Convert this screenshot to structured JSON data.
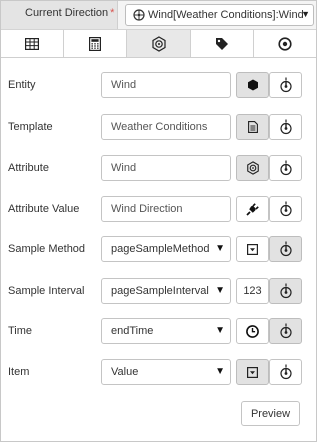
{
  "header": {
    "label": "Current Direction",
    "required_marker": "*",
    "selected": "Wind[Weather Conditions]:Wind Direction"
  },
  "tabs": [
    {
      "icon": "table-icon",
      "active": false
    },
    {
      "icon": "calculator-icon",
      "active": false
    },
    {
      "icon": "wind-icon",
      "active": true
    },
    {
      "icon": "tag-icon",
      "active": false
    },
    {
      "icon": "target-icon",
      "active": false
    }
  ],
  "rows": [
    {
      "label": "Entity",
      "value": "Wind",
      "kind": "text",
      "button1_icon": "hexagon-icon",
      "button1_pressed": true,
      "button2_icon": "pin-icon",
      "button2_pressed": false
    },
    {
      "label": "Template",
      "value": "Weather Conditions",
      "kind": "text",
      "button1_icon": "document-icon",
      "button1_pressed": true,
      "button2_icon": "pin-icon",
      "button2_pressed": false
    },
    {
      "label": "Attribute",
      "value": "Wind",
      "kind": "text",
      "button1_icon": "wind-icon",
      "button1_pressed": true,
      "button2_icon": "pin-icon",
      "button2_pressed": false
    },
    {
      "label": "Attribute Value",
      "value": "Wind Direction",
      "kind": "text",
      "button1_icon": "plug-icon",
      "button1_pressed": false,
      "button2_icon": "pin-icon",
      "button2_pressed": false
    },
    {
      "label": "Sample Method",
      "value": "pageSampleMethod",
      "kind": "select",
      "button1_icon": "dropdown-icon",
      "button1_pressed": false,
      "button2_icon": "pin-icon",
      "button2_pressed": true
    },
    {
      "label": "Sample Interval",
      "value": "pageSampleInterval",
      "kind": "select",
      "button1_text": "123",
      "button1_pressed": false,
      "button2_icon": "pin-icon",
      "button2_pressed": true
    },
    {
      "label": "Time",
      "value": "endTime",
      "kind": "select",
      "button1_icon": "clock-icon",
      "button1_pressed": false,
      "button2_icon": "pin-icon",
      "button2_pressed": true
    },
    {
      "label": "Item",
      "value": "Value",
      "kind": "select",
      "button1_icon": "dropdown-icon",
      "button1_pressed": true,
      "button2_icon": "pin-icon",
      "button2_pressed": false
    }
  ],
  "preview_button": "Preview",
  "colors": {
    "required": "#d9534f",
    "pressed": "#e2e2e2",
    "header_bg": "#e4e4e4"
  }
}
